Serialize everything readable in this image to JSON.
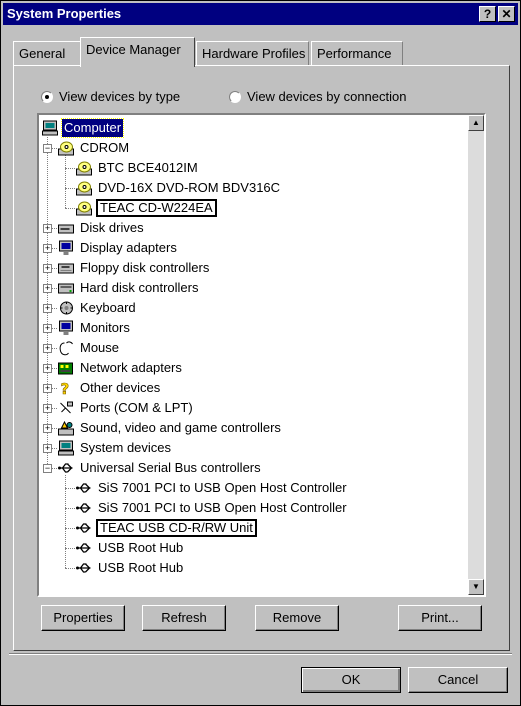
{
  "window": {
    "title": "System Properties",
    "help_btn": "?",
    "close_btn": "✕"
  },
  "tabs": [
    {
      "label": "General"
    },
    {
      "label": "Device Manager"
    },
    {
      "label": "Hardware Profiles"
    },
    {
      "label": "Performance"
    }
  ],
  "view": {
    "by_type": "View devices by type",
    "by_connection": "View devices by connection",
    "selected": "by_type"
  },
  "tree": [
    {
      "label": "Computer",
      "level": 0,
      "icon": "computer-icon",
      "selected": true
    },
    {
      "label": "CDROM",
      "level": 1,
      "icon": "cdrom-icon",
      "expander": "-"
    },
    {
      "label": "BTC BCE4012IM",
      "level": 2,
      "icon": "cdrom-icon"
    },
    {
      "label": "DVD-16X DVD-ROM BDV316C",
      "level": 2,
      "icon": "cdrom-icon"
    },
    {
      "label": "TEAC CD-W224EA",
      "level": 2,
      "icon": "cdrom-icon",
      "highlight": true
    },
    {
      "label": "Disk drives",
      "level": 1,
      "icon": "disk-drive-icon",
      "expander": "+"
    },
    {
      "label": "Display adapters",
      "level": 1,
      "icon": "monitor-icon",
      "expander": "+"
    },
    {
      "label": "Floppy disk controllers",
      "level": 1,
      "icon": "floppy-controller-icon",
      "expander": "+"
    },
    {
      "label": "Hard disk controllers",
      "level": 1,
      "icon": "hard-disk-controller-icon",
      "expander": "+"
    },
    {
      "label": "Keyboard",
      "level": 1,
      "icon": "keyboard-icon",
      "expander": "+"
    },
    {
      "label": "Monitors",
      "level": 1,
      "icon": "monitor-icon",
      "expander": "+"
    },
    {
      "label": "Mouse",
      "level": 1,
      "icon": "mouse-icon",
      "expander": "+"
    },
    {
      "label": "Network adapters",
      "level": 1,
      "icon": "network-adapter-icon",
      "expander": "+"
    },
    {
      "label": "Other devices",
      "level": 1,
      "icon": "question-mark-icon",
      "expander": "+"
    },
    {
      "label": "Ports (COM & LPT)",
      "level": 1,
      "icon": "port-icon",
      "expander": "+"
    },
    {
      "label": "Sound, video and game controllers",
      "level": 1,
      "icon": "sound-controller-icon",
      "expander": "+"
    },
    {
      "label": "System devices",
      "level": 1,
      "icon": "computer-icon",
      "expander": "+"
    },
    {
      "label": "Universal Serial Bus controllers",
      "level": 1,
      "icon": "usb-icon",
      "expander": "-"
    },
    {
      "label": "SiS 7001 PCI to USB Open Host Controller",
      "level": 2,
      "icon": "usb-icon"
    },
    {
      "label": "SiS 7001 PCI to USB Open Host Controller",
      "level": 2,
      "icon": "usb-icon"
    },
    {
      "label": "TEAC USB CD-R/RW Unit",
      "level": 2,
      "icon": "usb-icon",
      "highlight": true
    },
    {
      "label": "USB Root Hub",
      "level": 2,
      "icon": "usb-icon"
    },
    {
      "label": "USB Root Hub",
      "level": 2,
      "icon": "usb-icon"
    }
  ],
  "buttons": {
    "properties": "Properties",
    "refresh": "Refresh",
    "remove": "Remove",
    "print": "Print...",
    "ok": "OK",
    "cancel": "Cancel"
  },
  "colors": {
    "face": "#c0c0c0",
    "title_bar": "#000080",
    "selection": "#000080"
  }
}
